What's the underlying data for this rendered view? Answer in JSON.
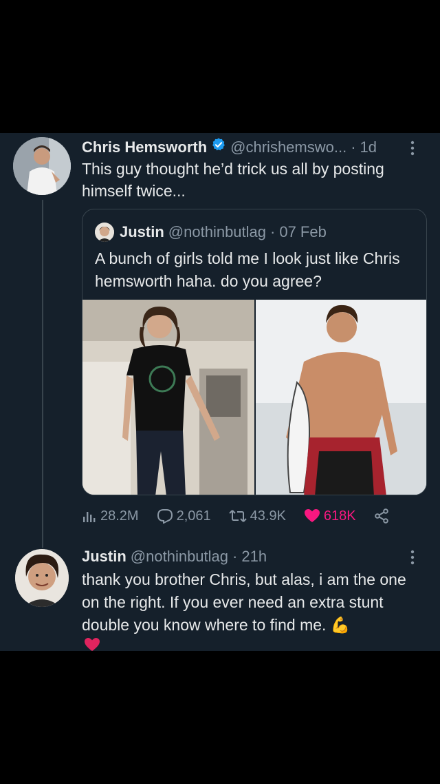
{
  "tweet": {
    "author_name": "Chris Hemsworth",
    "author_handle": "@chrishemswo...",
    "separator": "·",
    "time": "1d",
    "text": "This guy thought he’d trick us all by posting himself twice...",
    "more_icon": "more-vertical-icon",
    "verified_icon": "verified-badge-icon"
  },
  "quoted_tweet": {
    "author_name": "Justin",
    "author_handle": "@nothinbutlag",
    "separator": "·",
    "date": "07 Feb",
    "text": "A bunch of girls told me I look just like Chris hemsworth haha. do you agree?",
    "photos": [
      "photo-justin",
      "photo-chris-hemsworth"
    ]
  },
  "actions": {
    "views": "28.2M",
    "replies": "2,061",
    "retweets": "43.9K",
    "likes": "618K"
  },
  "reply": {
    "author_name": "Justin",
    "author_handle": "@nothinbutlag",
    "separator": "·",
    "time": "21h",
    "text": "thank you brother Chris, but alas, i am the one on the right. If you ever need an extra stunt double you know where to find me.",
    "emoji": "💪"
  },
  "colors": {
    "background": "#15202b",
    "text": "#e7e9ea",
    "muted": "#8b98a5",
    "like": "#f91880",
    "verified": "#1d9bf0",
    "border": "#38444d"
  }
}
